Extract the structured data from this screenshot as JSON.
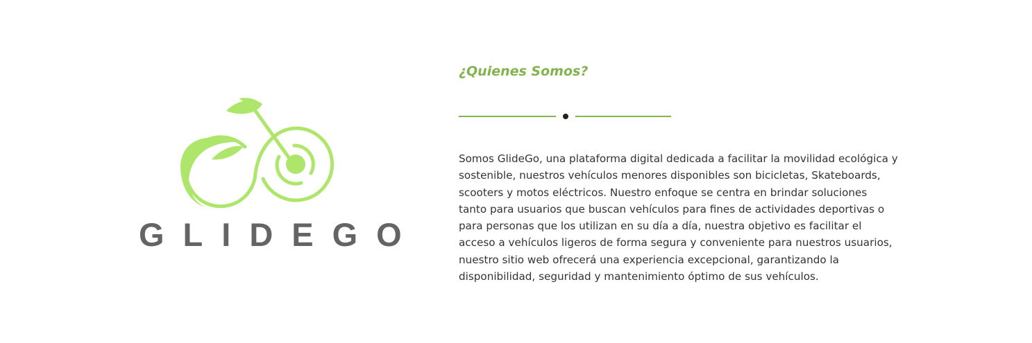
{
  "logo": {
    "brand_name": "GLIDEGO",
    "color": "#a8e063"
  },
  "about": {
    "title": "¿Quienes Somos?",
    "accent_color": "#82b34c",
    "lines": [
      "Somos GlideGo, una plataforma digital dedicada a facilitar la movilidad ecológica y",
      "sostenible, nuestros vehículos menores disponibles son bicicletas, Skateboards,",
      "scooters y motos eléctricos. Nuestro enfoque se centra en brindar soluciones",
      "tanto para usuarios que buscan vehículos para fines de actividades deportivas o",
      "para personas que los utilizan en su día a día, nuestra objetivo es facilitar el",
      "acceso a vehículos ligeros de forma segura y conveniente para nuestros usuarios,",
      "nuestro sitio web ofrecerá una experiencia excepcional, garantizando la",
      "disponibilidad, seguridad y mantenimiento óptimo de sus vehículos."
    ]
  }
}
